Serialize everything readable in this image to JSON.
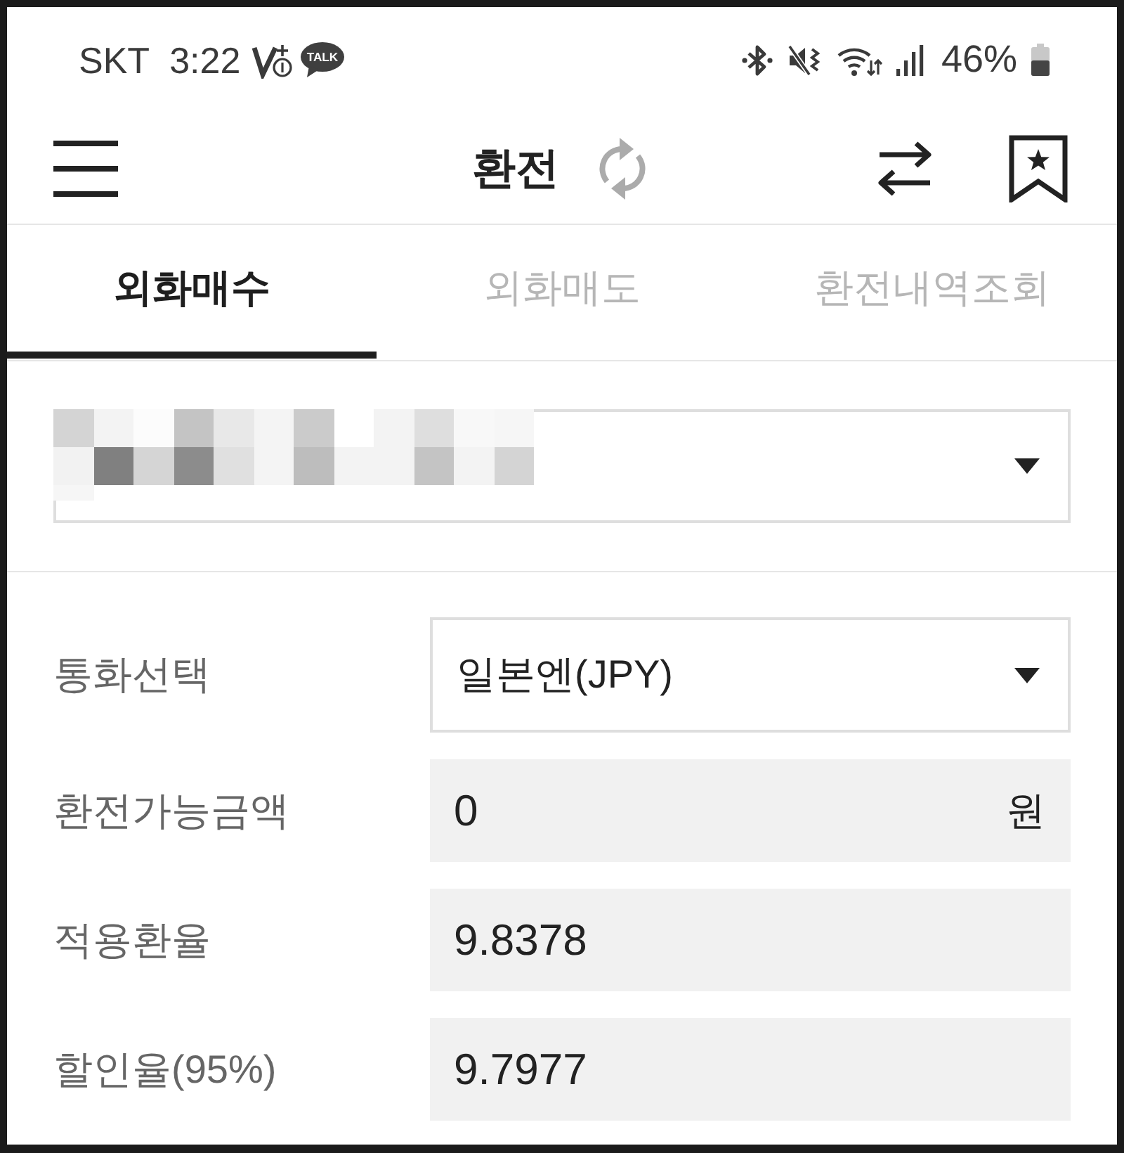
{
  "status_bar": {
    "carrier": "SKT",
    "time": "3:22",
    "app_badge": "TALK",
    "battery": "46%"
  },
  "app_bar": {
    "title": "환전"
  },
  "tabs": [
    {
      "label": "외화매수",
      "selected": true
    },
    {
      "label": "외화매도",
      "selected": false
    },
    {
      "label": "환전내역조회",
      "selected": false
    }
  ],
  "account_select": {
    "redacted": true
  },
  "form": [
    {
      "kind": "select",
      "label": "통화선택",
      "value": "일본엔(JPY)"
    },
    {
      "kind": "readonly",
      "label": "환전가능금액",
      "value": "0",
      "unit": "원"
    },
    {
      "kind": "readonly",
      "label": "적용환율",
      "value": "9.8378"
    },
    {
      "kind": "readonly",
      "label": "할인율(95%)",
      "value": "9.7977"
    }
  ]
}
